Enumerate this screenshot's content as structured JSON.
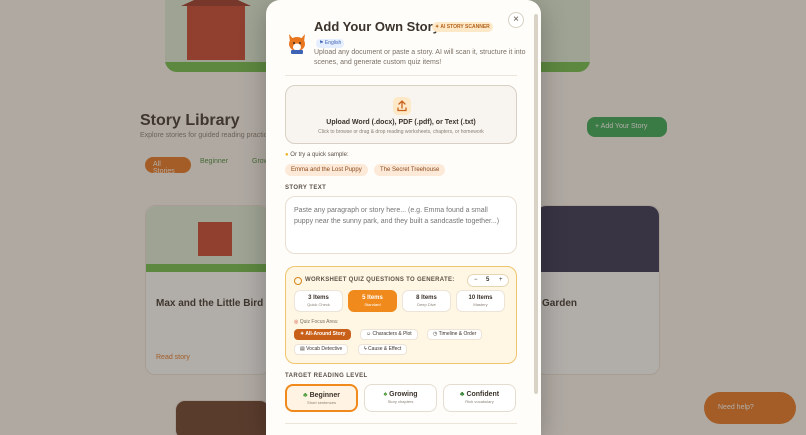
{
  "background": {
    "library_title": "Story Library",
    "library_subtitle": "Explore stories for guided reading practice",
    "filters": [
      "All Stories",
      "Beginner",
      "Growing"
    ],
    "add_story_button": "+ Add Your Story",
    "card_titles": [
      "Max and the Little Bird",
      "Garden"
    ],
    "card_link": "Read story",
    "float_button": "Need help?"
  },
  "modal": {
    "title": "Add Your Own Story",
    "ai_badge": "AI STORY SCANNER",
    "language_badge": "English",
    "subtitle": "Upload any document or paste a story. AI will scan it, structure it into scenes, and generate custom quiz items!",
    "close_label": "×",
    "upload": {
      "label": "Upload Word (.docx), PDF (.pdf), or Text (.txt)",
      "hint": "Click to browse or drag & drop reading worksheets, chapters, or homework"
    },
    "sample_label": "Or try a quick sample:",
    "samples": [
      "Emma and the Lost Puppy",
      "The Secret Treehouse"
    ],
    "story_text_label": "STORY TEXT",
    "story_text_placeholder": "Paste any paragraph or story here... (e.g. Emma found a small puppy near the sunny park, and they built a sandcastle together...)",
    "quiz": {
      "heading": "WORKSHEET QUIZ QUESTIONS TO GENERATE:",
      "stepper_minus": "−",
      "stepper_value": "5",
      "stepper_plus": "+",
      "counts": [
        {
          "name": "3 Items",
          "desc": "Quick Check"
        },
        {
          "name": "5 Items",
          "desc": "Standard"
        },
        {
          "name": "8 Items",
          "desc": "Deep Dive"
        },
        {
          "name": "10 Items",
          "desc": "Mastery"
        }
      ],
      "selected_count_index": 1,
      "focus_label": "Quiz Focus Area:",
      "focus_options": [
        "All-Around Story",
        "Characters & Plot",
        "Timeline & Order",
        "Vocab Detective",
        "Cause & Effect"
      ],
      "selected_focus_index": 0
    },
    "reading_level_label": "TARGET READING LEVEL",
    "levels": [
      {
        "name": "Beginner",
        "desc": "Short sentences"
      },
      {
        "name": "Growing",
        "desc": "Story chapters"
      },
      {
        "name": "Confident",
        "desc": "Rich vocabulary"
      }
    ],
    "selected_level_index": 0
  },
  "colors": {
    "accent": "#f08a1c",
    "panel": "#fff7e3",
    "overlay": "rgba(70,60,50,0.42)"
  },
  "icons": {
    "close": "close-icon",
    "upload": "upload-icon",
    "mascot": "fox-icon",
    "sample": "lightbulb-icon",
    "quiz": "info-icon"
  }
}
